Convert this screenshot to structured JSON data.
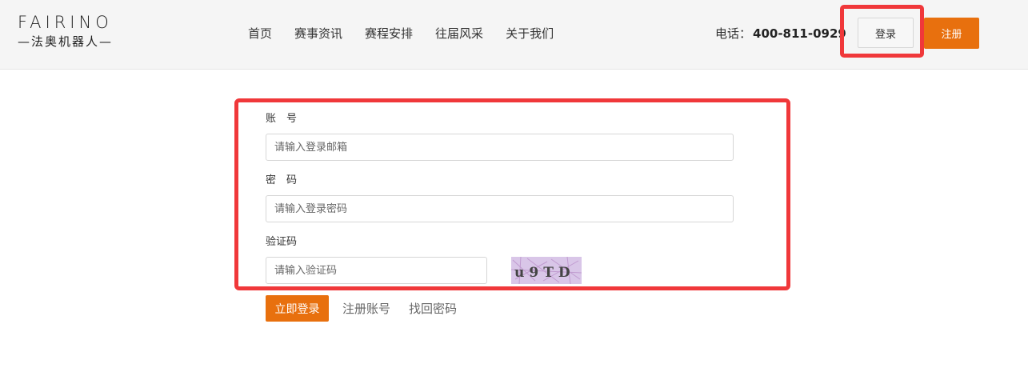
{
  "brand": {
    "logo_en": "FAIRINO",
    "logo_cn": "—法奥机器人—"
  },
  "nav": {
    "items": [
      {
        "label": "首页"
      },
      {
        "label": "赛事资讯"
      },
      {
        "label": "赛程安排"
      },
      {
        "label": "往届风采"
      },
      {
        "label": "关于我们"
      }
    ]
  },
  "header": {
    "phone_label": "电话：",
    "phone_number": "400-811-0929",
    "login_label": "登录",
    "register_label": "注册"
  },
  "form": {
    "account_label": "账　号",
    "account_placeholder": "请输入登录邮箱",
    "password_label": "密　码",
    "password_placeholder": "请输入登录密码",
    "captcha_label": "验证码",
    "captcha_placeholder": "请输入验证码",
    "captcha_text": "u9TD",
    "submit_label": "立即登录",
    "register_link": "注册账号",
    "recover_link": "找回密码"
  },
  "colors": {
    "accent": "#e8700e",
    "highlight": "#f0383a",
    "captcha_bg": "#d9c6e8"
  }
}
